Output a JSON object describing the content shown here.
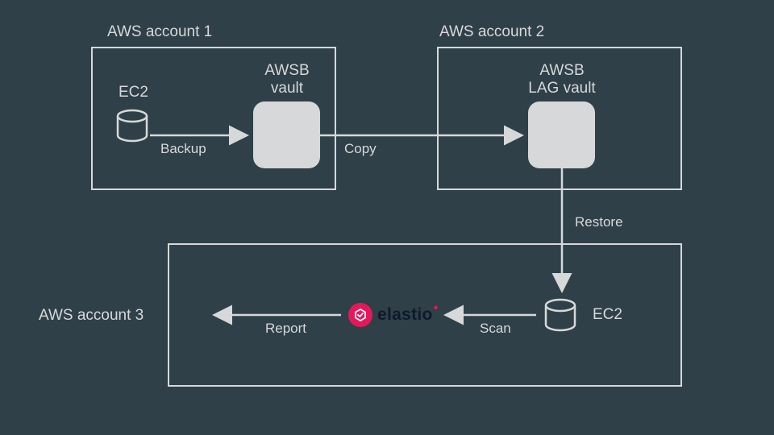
{
  "accounts": {
    "a1": {
      "label": "AWS account 1"
    },
    "a2": {
      "label": "AWS account 2"
    },
    "a3": {
      "label": "AWS account 3"
    }
  },
  "nodes": {
    "ec2_1": {
      "label": "EC2"
    },
    "vault1": {
      "line1": "AWSB",
      "line2": "vault"
    },
    "vault2": {
      "line1": "AWSB",
      "line2": "LAG vault"
    },
    "ec2_2": {
      "label": "EC2"
    },
    "elastio": {
      "label": "elastio"
    }
  },
  "flows": {
    "backup": {
      "label": "Backup"
    },
    "copy": {
      "label": "Copy"
    },
    "restore": {
      "label": "Restore"
    },
    "scan": {
      "label": "Scan"
    },
    "report": {
      "label": "Report"
    }
  },
  "colors": {
    "bg": "#2f4048",
    "stroke": "#d6d8da",
    "accent": "#e5195a"
  }
}
